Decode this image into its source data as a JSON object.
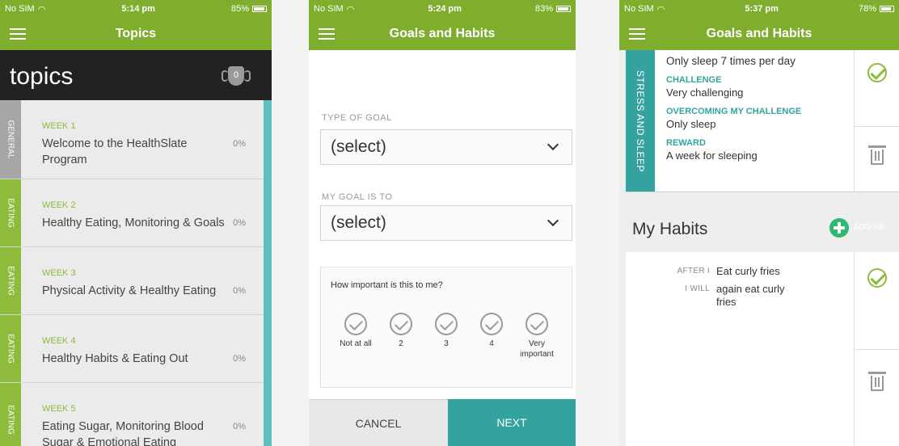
{
  "phone1": {
    "status": {
      "carrier": "No SIM",
      "time": "5:14 pm",
      "battery": "85%"
    },
    "nav_title": "Topics",
    "header_title": "topics",
    "badge_count": "0",
    "colors": {
      "accent": "#7fad2e",
      "general": "#a6a6a6",
      "eating": "#8dbb3b",
      "rail": "#5fbfbf"
    },
    "topics": [
      {
        "category": "GENERAL",
        "week": "WEEK 1",
        "title": "Welcome to the HealthSlate Program",
        "progress": "0%"
      },
      {
        "category": "EATING",
        "week": "WEEK 2",
        "title": "Healthy Eating, Monitoring & Goals",
        "progress": "0%"
      },
      {
        "category": "EATING",
        "week": "WEEK 3",
        "title": "Physical Activity & Healthy Eating",
        "progress": "0%"
      },
      {
        "category": "EATING",
        "week": "WEEK 4",
        "title": "Healthy Habits & Eating Out",
        "progress": "0%"
      },
      {
        "category": "EATING",
        "week": "WEEK 5",
        "title": "Eating Sugar, Monitoring Blood Sugar & Emotional Eating",
        "progress": "0%"
      }
    ]
  },
  "phone2": {
    "status": {
      "carrier": "No SIM",
      "time": "5:24 pm",
      "battery": "83%"
    },
    "nav_title": "Goals and Habits",
    "type_label": "TYPE OF GOAL",
    "type_value": "(select)",
    "goal_label": "MY GOAL IS TO",
    "goal_value": "(select)",
    "importance_question": "How important is this to me?",
    "rating_options": [
      "Not at all",
      "2",
      "3",
      "4",
      "Very important"
    ],
    "cancel_label": "CANCEL",
    "next_label": "NEXT"
  },
  "phone3": {
    "status": {
      "carrier": "No SIM",
      "time": "5:37 pm",
      "battery": "78%"
    },
    "nav_title": "Goals and Habits",
    "goal": {
      "category": "STRESS AND SLEEP",
      "goal_text": "Only sleep 7 times per day",
      "challenge_label": "CHALLENGE",
      "challenge_value": "Very challenging",
      "overcoming_label": "OVERCOMING MY CHALLENGE",
      "overcoming_value": "Only sleep",
      "reward_label": "REWARD",
      "reward_value": "A week for sleeping"
    },
    "habits_title": "My Habits",
    "add_habit_label": "ADD HA",
    "habit": {
      "after_label": "AFTER I",
      "after_value": "Eat curly fries",
      "will_label": "I WILL",
      "will_value": "again eat curly fries"
    }
  }
}
